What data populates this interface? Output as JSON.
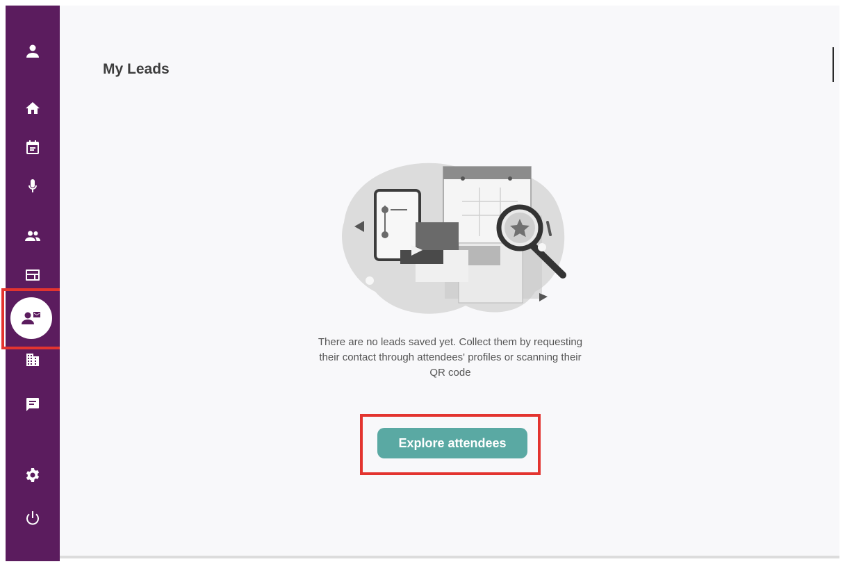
{
  "sidebar": {
    "background": "#5b1c5e",
    "items": [
      {
        "name": "profile",
        "icon": "person-icon"
      },
      {
        "name": "home",
        "icon": "home-icon"
      },
      {
        "name": "agenda",
        "icon": "calendar-icon"
      },
      {
        "name": "speakers",
        "icon": "microphone-icon"
      },
      {
        "name": "attendees",
        "icon": "people-icon"
      },
      {
        "name": "sessions",
        "icon": "layout-icon"
      },
      {
        "name": "leads",
        "icon": "contact-mail-icon",
        "active": true
      },
      {
        "name": "exhibitors",
        "icon": "building-icon"
      },
      {
        "name": "messages",
        "icon": "chat-icon"
      },
      {
        "name": "settings",
        "icon": "gear-icon"
      },
      {
        "name": "logout",
        "icon": "power-icon"
      }
    ]
  },
  "main": {
    "title": "My Leads",
    "empty_message": "There are no leads saved yet. Collect them by requesting their contact through attendees' profiles or scanning their QR code",
    "explore_button": "Explore attendees",
    "accent_color": "#5aa9a3",
    "highlight_color": "#e3342f"
  }
}
